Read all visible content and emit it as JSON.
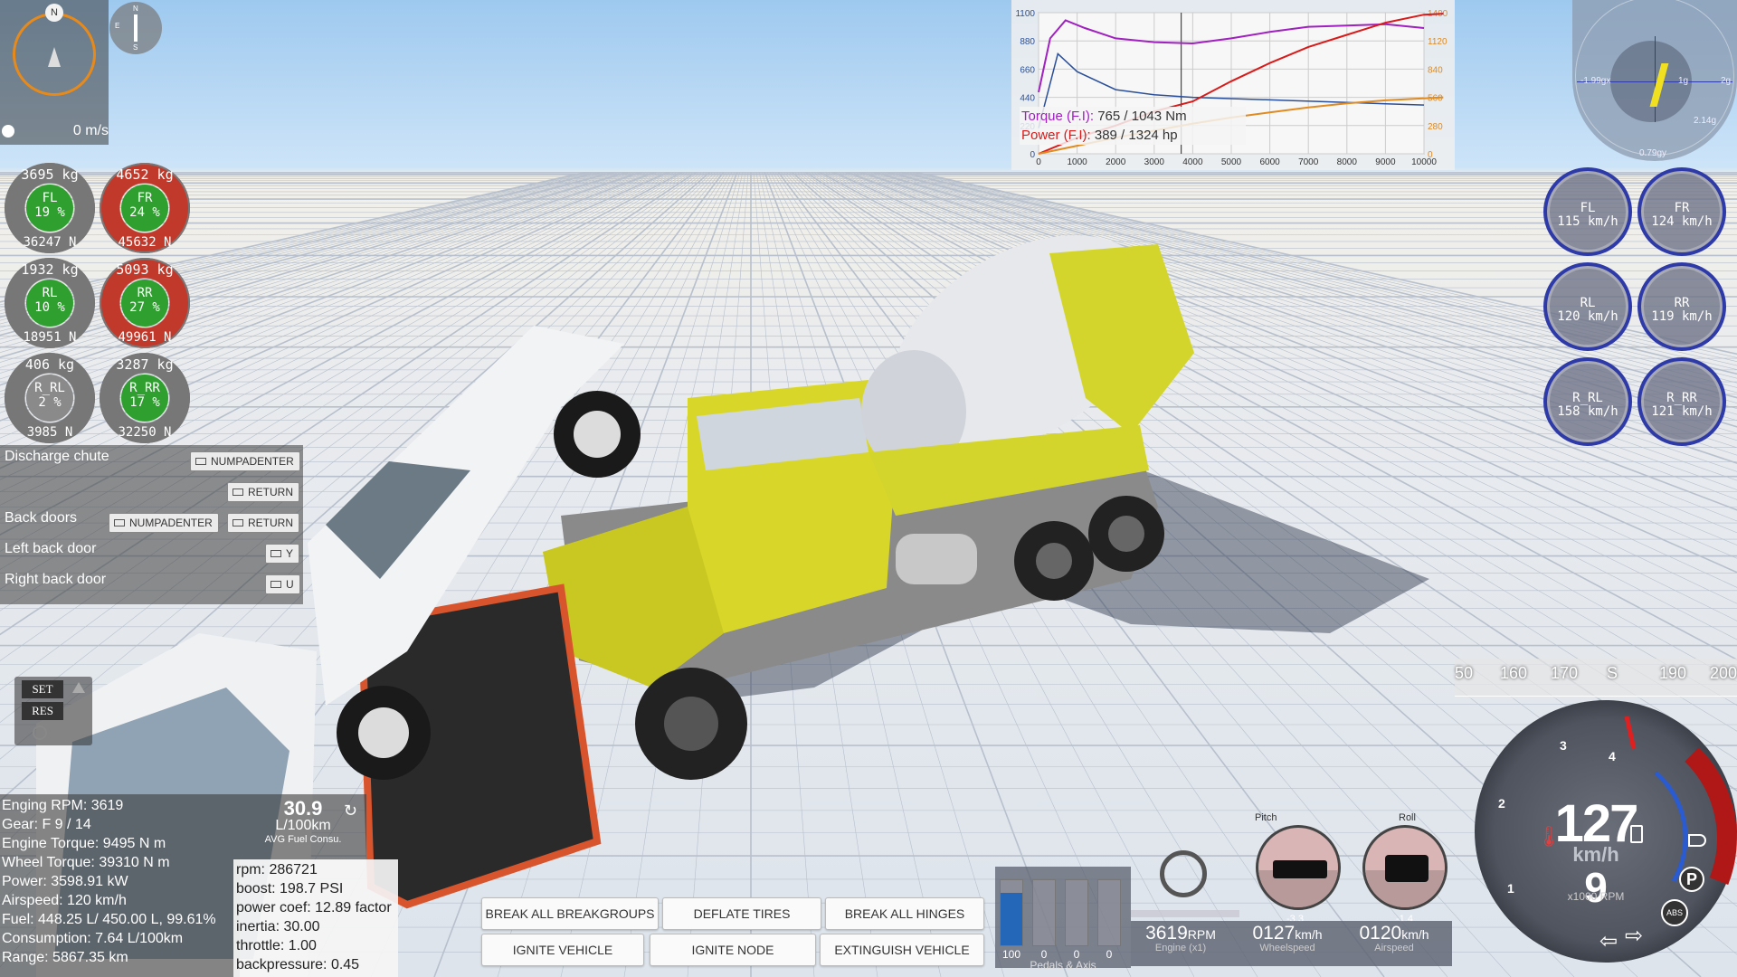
{
  "minimap": {
    "speed": "0 m/s",
    "north": "N"
  },
  "compass": {
    "n": "N",
    "s": "S",
    "e": "E"
  },
  "wheel_loads": [
    {
      "id": "FL",
      "kg": "3695  kg",
      "label": "FL",
      "pct": "19 %",
      "newton": "36247  N",
      "color": "#2fa02f",
      "ring": "#777777"
    },
    {
      "id": "FR",
      "kg": "4652  kg",
      "label": "FR",
      "pct": "24 %",
      "newton": "45632  N",
      "color": "#2fa02f",
      "ring": "#c0392b"
    },
    {
      "id": "RL",
      "kg": "1932  kg",
      "label": "RL",
      "pct": "10 %",
      "newton": "18951  N",
      "color": "#2fa02f",
      "ring": "#777777"
    },
    {
      "id": "RR",
      "kg": "5093  kg",
      "label": "RR",
      "pct": "27 %",
      "newton": "49961  N",
      "color": "#2fa02f",
      "ring": "#c0392b"
    },
    {
      "id": "R_RL",
      "kg": "406  kg",
      "label": "R_RL",
      "pct": "2 %",
      "newton": "3985  N",
      "color": "#8a8a8a",
      "ring": "#777777"
    },
    {
      "id": "R_RR",
      "kg": "3287  kg",
      "label": "R_RR",
      "pct": "17 %",
      "newton": "32250  N",
      "color": "#2fa02f",
      "ring": "#777777"
    }
  ],
  "controls": {
    "discharge_chute": "Discharge chute",
    "back_doors": "Back doors",
    "left_back_door": "Left back door",
    "right_back_door": "Right back door",
    "key_numpadenter": "NUMPADENTER",
    "key_return": "RETURN",
    "key_y": "Y",
    "key_u": "U"
  },
  "cruise": {
    "set": "SET",
    "res": "RES"
  },
  "engine_info": {
    "rpm": "Enging RPM: 3619",
    "gear": "Gear: F 9 / 14",
    "engine_torque": "Engine Torque: 9495 N m",
    "wheel_torque": "Wheel Torque: 39310 N m",
    "power": "Power: 3598.91 kW",
    "airspeed": "Airspeed: 120 km/h",
    "fuel": "Fuel: 448.25 L/ 450.00 L, 99.61%",
    "consumption": "Consumption: 7.64 L/100km",
    "range": "Range: 5867.35 km"
  },
  "fuel_avg": {
    "value": "30.9",
    "unit": "L/100km",
    "caption": "AVG Fuel Consu."
  },
  "debug": {
    "rpm": "rpm: 286721",
    "boost": "boost: 198.7 PSI",
    "power_coef": "power coef: 12.89 factor",
    "inertia": "inertia: 30.00",
    "throttle": "throttle: 1.00",
    "backpressure": "backpressure: 0.45"
  },
  "torque_graph": {
    "left_ticks": [
      "1100",
      "880",
      "660",
      "440",
      "220",
      "0"
    ],
    "right_ticks": [
      "1400",
      "1120",
      "840",
      "560",
      "280",
      "0"
    ],
    "x_ticks": [
      "0",
      "1000",
      "2000",
      "3000",
      "4000",
      "5000",
      "6000",
      "7000",
      "8000",
      "9000",
      "10000"
    ],
    "torque_label": "Torque (F.I):",
    "torque_value": "765 / 1043 Nm",
    "power_label": "Power (F.I):",
    "power_value": "389 / 1324 hp",
    "colors": {
      "torque": "#a020c0",
      "power": "#d91a1a",
      "torque_base": "#2a4f9a",
      "power_base": "#e08a20"
    }
  },
  "gforce": {
    "x": "-1.99gx",
    "one_g": "1g",
    "two_g": "2g",
    "side": "2.14g",
    "y": "0.79gy"
  },
  "wheel_speeds": [
    {
      "label": "FL",
      "speed": "115 km/h"
    },
    {
      "label": "FR",
      "speed": "124 km/h"
    },
    {
      "label": "RL",
      "speed": "120 km/h"
    },
    {
      "label": "RR",
      "speed": "119 km/h"
    },
    {
      "label": "R_RL",
      "speed": "158 km/h"
    },
    {
      "label": "R_RR",
      "speed": "121 km/h"
    }
  ],
  "actions": {
    "break_breakgroups": "BREAK ALL BREAKGROUPS",
    "deflate_tires": "DEFLATE TIRES",
    "break_hinges": "BREAK ALL HINGES",
    "ignite_vehicle": "IGNITE VEHICLE",
    "ignite_node": "IGNITE NODE",
    "extinguish_vehicle": "EXTINGUISH VEHICLE"
  },
  "pedals": {
    "values": [
      "100",
      "0",
      "0",
      "0"
    ],
    "levels": [
      0.8,
      0,
      0,
      0
    ],
    "caption": "Pedals & Axis"
  },
  "readouts": {
    "rpm_value": "3619",
    "rpm_unit": "RPM",
    "rpm_caption": "Engine (x1)",
    "wheel_value": "0127",
    "wheel_unit": "km/h",
    "wheel_caption": "Wheelspeed",
    "air_value": "0120",
    "air_unit": "km/h",
    "air_caption": "Airspeed"
  },
  "attitude": {
    "pitch": "Pitch",
    "roll": "Roll",
    "pitch_val": "-3.3",
    "roll_val": "-1.4"
  },
  "speedo_tape": {
    "marks": [
      "50",
      "160",
      "170",
      "S",
      "190",
      "200"
    ]
  },
  "speedometer": {
    "speed": "127",
    "unit": "km/h",
    "gear": "9",
    "rpm_label": "x1000 RPM",
    "ticks": [
      "1",
      "2",
      "3",
      "4"
    ],
    "park": "P",
    "abs": "ABS"
  }
}
